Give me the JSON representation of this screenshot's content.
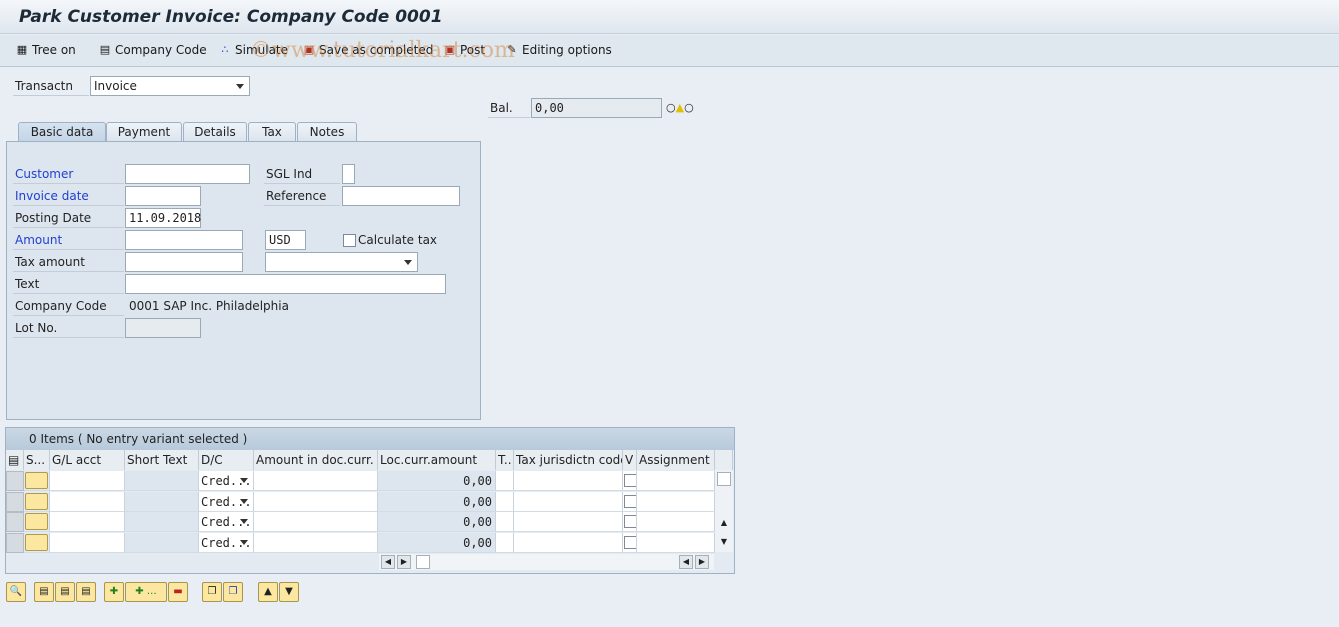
{
  "title": "Park Customer Invoice: Company Code 0001",
  "watermark": "©www.tutorialkart.com",
  "toolbar": {
    "tree_on": "Tree on",
    "company_code": "Company Code",
    "simulate": "Simulate",
    "save_completed": "Save as completed",
    "post": "Post",
    "editing_options": "Editing options"
  },
  "header": {
    "transaction_label": "Transactn",
    "transaction_value": "Invoice",
    "balance_label": "Bal.",
    "balance_value": "0,00",
    "status_icons": "traffic-light-yellow"
  },
  "tabs": [
    "Basic data",
    "Payment",
    "Details",
    "Tax",
    "Notes"
  ],
  "form": {
    "customer_label": "Customer",
    "customer_value": "",
    "sgl_label": "SGL Ind",
    "sgl_value": "",
    "invoice_date_label": "Invoice date",
    "invoice_date_value": "",
    "reference_label": "Reference",
    "reference_value": "",
    "posting_date_label": "Posting Date",
    "posting_date_value": "11.09.2018",
    "amount_label": "Amount",
    "amount_value": "",
    "currency_value": "USD",
    "calculate_tax_label": "Calculate tax",
    "calculate_tax_checked": false,
    "tax_amount_label": "Tax amount",
    "tax_amount_value": "",
    "tax_code_value": "",
    "text_label": "Text",
    "text_value": "",
    "company_code_label": "Company Code",
    "company_code_value": "0001 SAP Inc. Philadelphia",
    "lot_no_label": "Lot No.",
    "lot_no_value": ""
  },
  "items": {
    "header": "0 Items ( No entry variant selected )",
    "columns": [
      "S...",
      "G/L acct",
      "Short Text",
      "D/C",
      "Amount in doc.curr.",
      "Loc.curr.amount",
      "T..",
      "Tax jurisdictn code",
      "V",
      "Assignment"
    ],
    "rows": [
      {
        "dc": "Cred...",
        "loc_amount": "0,00"
      },
      {
        "dc": "Cred...",
        "loc_amount": "0,00"
      },
      {
        "dc": "Cred...",
        "loc_amount": "0,00"
      },
      {
        "dc": "Cred...",
        "loc_amount": "0,00"
      }
    ]
  },
  "colors": {
    "label_blue": "#1f3fcf",
    "button_yellow": "#fbe7a0",
    "panel": "#dde6ef"
  }
}
